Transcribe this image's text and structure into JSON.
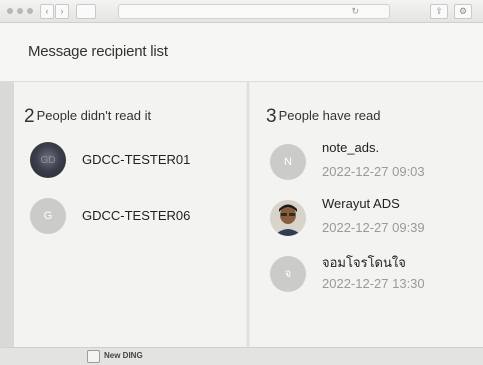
{
  "window": {
    "back_glyph": "‹",
    "forward_glyph": "›",
    "reload_glyph": "↻"
  },
  "header": {
    "title": "Message recipient list"
  },
  "unread": {
    "count": "2",
    "label": "People didn't read it",
    "people": [
      {
        "name": "GDCC-TESTER01",
        "avatar_initial": "GD",
        "avatar_style": "dark"
      },
      {
        "name": "GDCC-TESTER06",
        "avatar_initial": "G",
        "avatar_style": "light"
      }
    ]
  },
  "read": {
    "count": "3",
    "label": "People have read",
    "people": [
      {
        "name": "note_ads.",
        "time": "2022-12-27 09:03",
        "avatar_initial": "N"
      },
      {
        "name": "Werayut ADS",
        "time": "2022-12-27 09:39",
        "avatar_initial": ""
      },
      {
        "name": "จอมโจรโดนใจ",
        "time": "2022-12-27 13:30",
        "avatar_initial": "จ"
      }
    ]
  },
  "footer": {
    "label": "New DING"
  },
  "colors": {
    "avatar_gray": "#cbcbc9",
    "time_gray": "#9a9a98",
    "text": "#222222"
  }
}
